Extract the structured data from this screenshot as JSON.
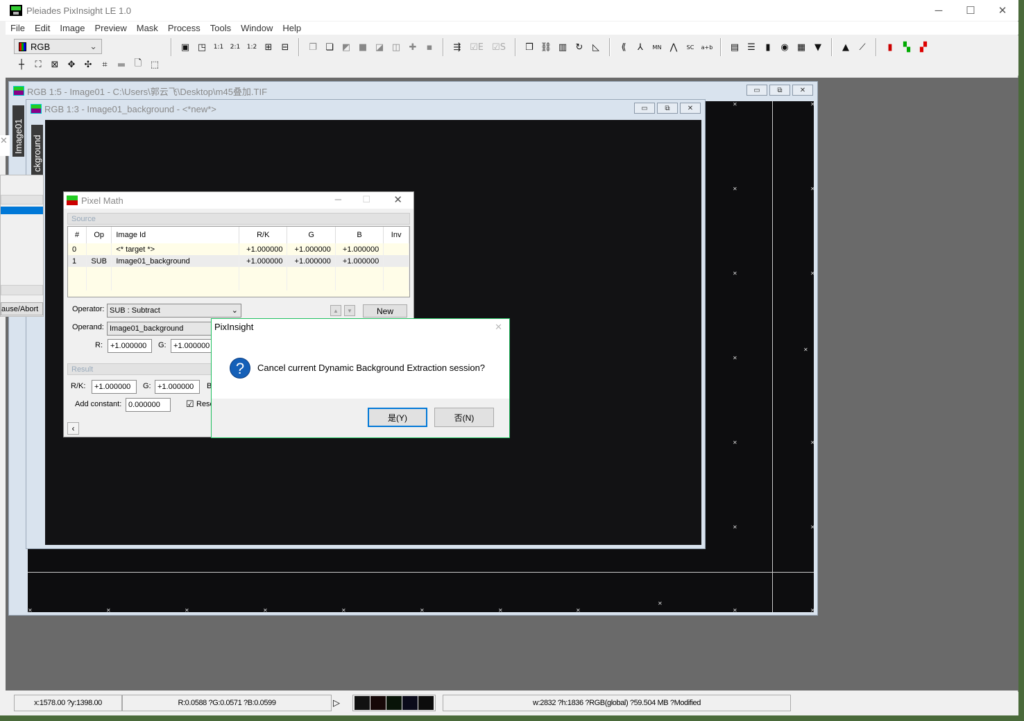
{
  "app": {
    "title": "Pleiades PixInsight LE 1.0",
    "window_controls": [
      "minimize",
      "maximize",
      "close"
    ]
  },
  "menu": [
    "File",
    "Edit",
    "Image",
    "Preview",
    "Mask",
    "Process",
    "Tools",
    "Window",
    "Help"
  ],
  "toolbar": {
    "color_mode": "RGB",
    "row2_icons": [
      "crosshair-icon",
      "zoom-fit-icon",
      "zoom-shrink-icon",
      "pan-icon",
      "move-icon",
      "crop-icon",
      "disabled-icon",
      "new-document-icon",
      "select-preview-icon"
    ],
    "row1_groups": [
      [
        "new-window-icon",
        "fit-window-icon",
        "zoom-1-1-icon",
        "zoom-2-1-icon",
        "zoom-1-2-icon",
        "zoom-in-icon",
        "zoom-out-icon"
      ],
      [
        "copy-icon",
        "clone-icon",
        "paste-icon",
        "stack-icon",
        "align-icon",
        "merge-icon",
        "center-icon",
        "fit-icon"
      ],
      [
        "process-icon",
        "check-e",
        "check-s"
      ],
      [
        "copy-window-icon",
        "graph-icon",
        "frame-icon",
        "rotate-icon",
        "corner-icon"
      ],
      [
        "wavelet-icon",
        "psf-icon",
        "minmax-icon",
        "noise-icon",
        "snr-icon",
        "math-icon"
      ],
      [
        "statistics-icon",
        "info-icon",
        "histogram-icon",
        "view-icon",
        "channels-icon",
        "monitor-icon"
      ],
      [
        "hist-transform-icon",
        "curves-icon"
      ],
      [
        "color-bars-icon",
        "rgb-split-icon",
        "rgb-merge-icon"
      ]
    ],
    "check_e": "E",
    "check_s": "S"
  },
  "windows": {
    "back": {
      "title": "RGB 1:5 - Image01 - C:\\Users\\郭云飞\\Desktop\\m45叠加.TIF",
      "tab": "Image01"
    },
    "front": {
      "title": "RGB 1:3 - Image01_background - <*new*>",
      "tab": "ckground"
    }
  },
  "left_panel": {
    "button": "ause/Abort"
  },
  "pixel_math": {
    "title": "Pixel Math",
    "source_label": "Source",
    "columns": [
      "#",
      "Op",
      "Image Id",
      "R/K",
      "G",
      "B",
      "Inv"
    ],
    "rows": [
      [
        "0",
        "",
        "<* target *>",
        "+1.000000",
        "+1.000000",
        "+1.000000",
        ""
      ],
      [
        "1",
        "SUB",
        "Image01_background",
        "+1.000000",
        "+1.000000",
        "+1.000000",
        ""
      ]
    ],
    "operator_label": "Operator:",
    "operator_value": "SUB : Subtract",
    "new_button": "New",
    "operand_label": "Operand:",
    "operand_value": "Image01_background",
    "r_label": "R:",
    "r_value": "+1.000000",
    "g_label": "G:",
    "g_value": "+1.000000",
    "result_label": "Result",
    "rk_label": "R/K:",
    "rk_value": "+1.000000",
    "rg_label": "G:",
    "rg_value": "+1.000000",
    "rb_label": "B",
    "add_constant_label": "Add constant:",
    "add_constant_value": "0.000000",
    "rescale_label": "Resc",
    "rescale_checked": true
  },
  "dialog": {
    "title": "PixInsight",
    "message": "Cancel current Dynamic Background Extraction session?",
    "yes": "是(Y)",
    "no": "否(N)"
  },
  "statusbar": {
    "coords": "x:1578.00 ?y:1398.00",
    "values": "R:0.0588 ?G:0.0571 ?B:0.0599",
    "swatches": [
      "#111111",
      "#160808",
      "#081408",
      "#0a0a1a",
      "#0c0c0c"
    ],
    "info": "w:2832 ?h:1836 ?RGB(global) ?59.504 MB ?Modified"
  }
}
